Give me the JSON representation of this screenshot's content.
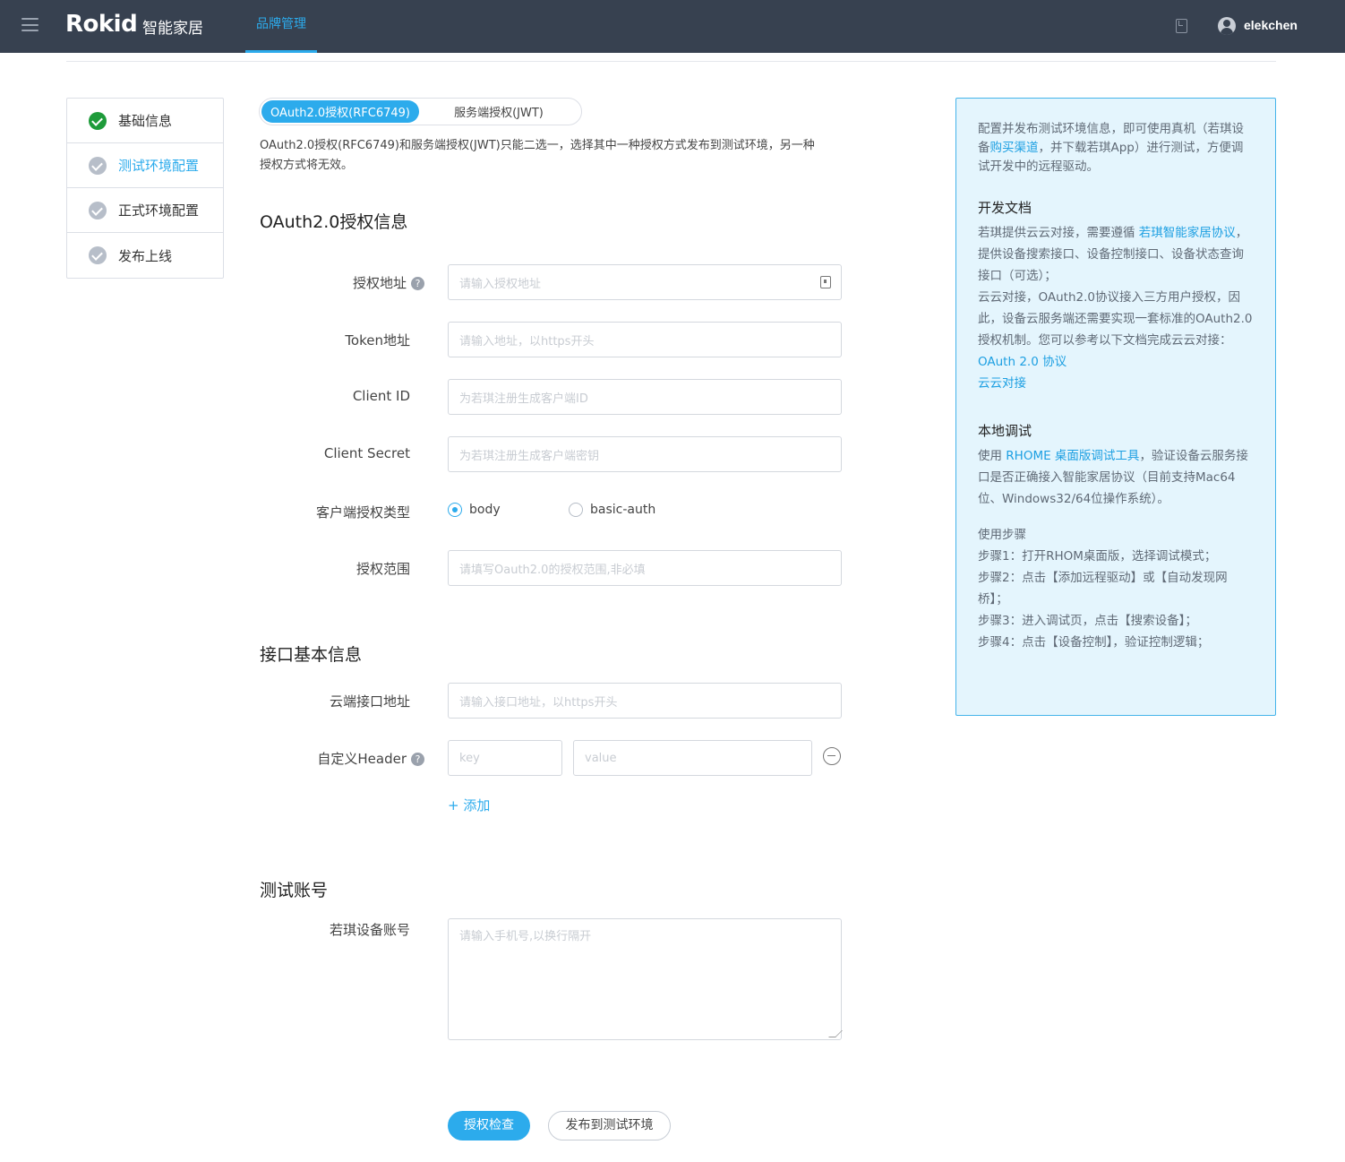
{
  "header": {
    "logo": "Rokid",
    "app_name": "智能家居",
    "nav_tab": "品牌管理",
    "username": "elekchen"
  },
  "steps": [
    {
      "label": "基础信息",
      "status": "done"
    },
    {
      "label": "测试环境配置",
      "status": "active"
    },
    {
      "label": "正式环境配置",
      "status": "pending"
    },
    {
      "label": "发布上线",
      "status": "pending"
    }
  ],
  "auth_tabs": {
    "oauth": "OAuth2.0授权(RFC6749)",
    "jwt": "服务端授权(JWT)"
  },
  "notice": "OAuth2.0授权(RFC6749)和服务端授权(JWT)只能二选一，选择其中一种授权方式发布到测试环境，另一种授权方式将无效。",
  "oauth_section": {
    "title": "OAuth2.0授权信息",
    "auth_url": {
      "label": "授权地址",
      "placeholder": "请输入授权地址"
    },
    "token_url": {
      "label": "Token地址",
      "placeholder": "请输入地址，以https开头"
    },
    "client_id": {
      "label": "Client ID",
      "placeholder": "为若琪注册生成客户端ID"
    },
    "client_secret": {
      "label": "Client Secret",
      "placeholder": "为若琪注册生成客户端密钥"
    },
    "client_auth_type": {
      "label": "客户端授权类型",
      "options": [
        "body",
        "basic-auth"
      ],
      "selected": "body"
    },
    "scope": {
      "label": "授权范围",
      "placeholder": "请填写Oauth2.0的授权范围,非必填"
    }
  },
  "api_section": {
    "title": "接口基本信息",
    "cloud_url": {
      "label": "云端接口地址",
      "placeholder": "请输入接口地址，以https开头"
    },
    "custom_header": {
      "label": "自定义Header",
      "key_placeholder": "key",
      "value_placeholder": "value",
      "add_label": "+ 添加"
    }
  },
  "test_section": {
    "title": "测试账号",
    "device_account": {
      "label": "若琪设备账号",
      "placeholder": "请输入手机号,以换行隔开"
    }
  },
  "buttons": {
    "check": "授权检查",
    "publish": "发布到测试环境"
  },
  "help_glyph": "?",
  "aside": {
    "intro_a": "配置并发布测试环境信息，即可使用真机（若琪设备",
    "intro_link": "购买渠道",
    "intro_b": "，并下载若琪App）进行测试，方便调试开发中的远程驱动。",
    "dev_title": "开发文档",
    "dev_a": "若琪提供云云对接，需要遵循 ",
    "dev_link": "若琪智能家居协议",
    "dev_b": "，提供设备搜索接口、设备控制接口、设备状态查询接口（可选）；",
    "dev_c": "云云对接，OAuth2.0协议接入三方用户授权，因此，设备云服务端还需要实现一套标准的OAuth2.0授权机制。您可以参考以下文档完成云云对接：",
    "link_oauth": "OAuth 2.0 协议",
    "link_cloud": "云云对接",
    "local_title": "本地调试",
    "local_a": "使用 ",
    "local_link": "RHOME 桌面版调试工具",
    "local_b": "，验证设备云服务接口是否正确接入智能家居协议（目前支持Mac64位、Windows32/64位操作系统）。",
    "steps_title": "使用步骤",
    "step1": "步骤1：打开RHOM桌面版，选择调试模式；",
    "step2": "步骤2：点击【添加远程驱动】或【自动发现网桥】；",
    "step3": "步骤3：进入调试页，点击【搜索设备】；",
    "step4": "步骤4：点击【设备控制】，验证控制逻辑；"
  },
  "colors": {
    "topbar": "#374150",
    "accent": "#2cabec",
    "done": "#1e9b3a",
    "aside_bg": "#e4f5fd"
  }
}
